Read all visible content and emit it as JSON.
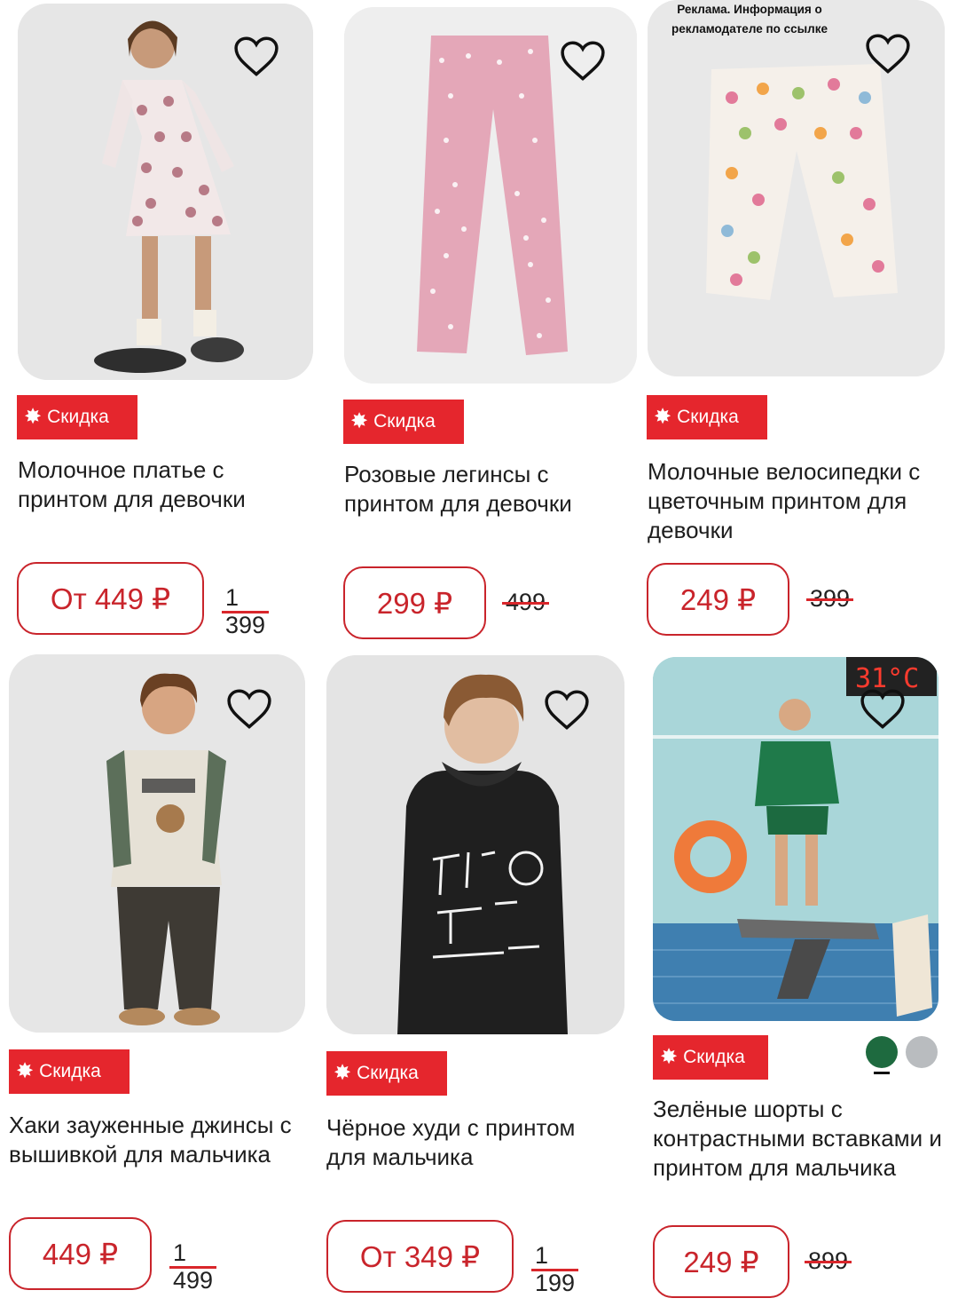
{
  "ad_notice": "Реклама. Информация о рекламодателе по ссылке",
  "badge_label": "Скидка",
  "colors": {
    "accent_red": "#e5262d",
    "price_red": "#c9242b",
    "swatch_green": "#1e6a3f",
    "swatch_gray": "#b9bcbf"
  },
  "products": [
    {
      "title": "Молочное платье с принтом для девочки",
      "price": "От 449 ₽",
      "old_price": "1 399"
    },
    {
      "title": "Розовые легинсы с принтом для девочки",
      "price": "299 ₽",
      "old_price": "499"
    },
    {
      "title": "Молочные велосипедки с цветочным принтом для девочки",
      "price": "249 ₽",
      "old_price": "399"
    },
    {
      "title": "Хаки зауженные джинсы с вышивкой для мальчика",
      "price": "449 ₽",
      "old_price": "1 499"
    },
    {
      "title": "Чёрное худи с принтом для мальчика",
      "price": "От 349 ₽",
      "old_price": "1 199"
    },
    {
      "title": "Зелёные шорты с контрастными вставками и принтом для мальчика",
      "price": "249 ₽",
      "old_price": "899",
      "scoreboard": "31°C"
    }
  ]
}
